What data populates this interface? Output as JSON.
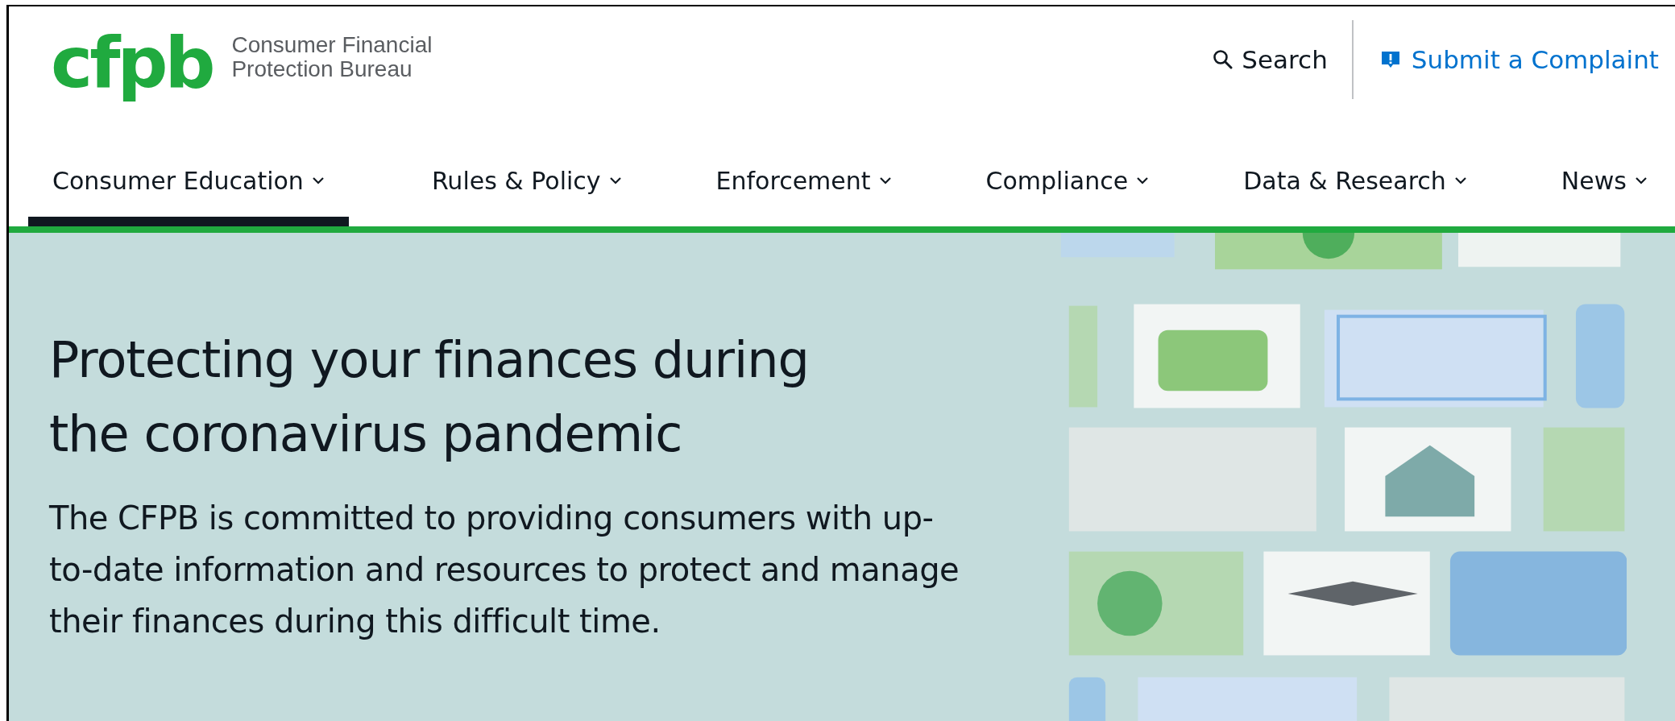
{
  "header": {
    "logo": "cfpb",
    "agency_name": [
      "Consumer Financial",
      "Protection Bureau"
    ],
    "search": "Search",
    "complaint": "Submit a Complaint"
  },
  "nav": [
    {
      "label": "Consumer Education",
      "selected": true
    },
    {
      "label": "Rules & Policy",
      "selected": false
    },
    {
      "label": "Enforcement",
      "selected": false
    },
    {
      "label": "Compliance",
      "selected": false
    },
    {
      "label": "Data & Research",
      "selected": false
    },
    {
      "label": "News",
      "selected": false
    }
  ],
  "hero": {
    "title": "Protecting your finances during the coronavirus pandemic",
    "text": "The CFPB is committed to providing consumers with up-to-date information and resources to protect and manage their finances during this difficult time."
  }
}
